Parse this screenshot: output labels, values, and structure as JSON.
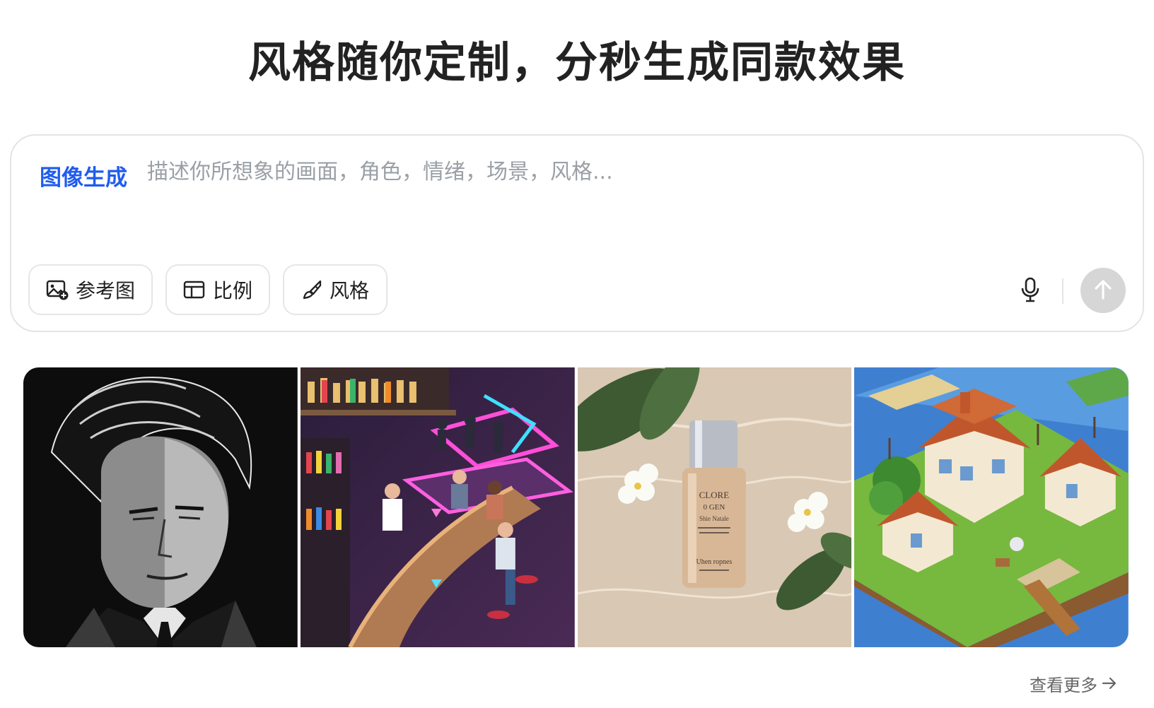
{
  "headline": "风格随你定制，分秒生成同款效果",
  "prompt_card": {
    "mode_label": "图像生成",
    "placeholder": "描述你所想象的画面，角色，情绪，场景，风格...",
    "value": "",
    "tools": [
      {
        "label": "参考图",
        "icon": "image-add-icon"
      },
      {
        "label": "比例",
        "icon": "aspect-ratio-icon"
      },
      {
        "label": "风格",
        "icon": "brush-icon"
      }
    ],
    "mic_icon": "microphone-icon",
    "send_icon": "arrow-up-icon"
  },
  "gallery": {
    "items": [
      {
        "subject": "manga-style-portrait"
      },
      {
        "subject": "neon-bar-scene"
      },
      {
        "subject": "cosmetic-bottle-product",
        "bottle_label_line1": "CLORE",
        "bottle_label_line2": "0 GEN",
        "bottle_label_line3": "Shie Natale",
        "bottle_label_line4": "Uhen ropnes"
      },
      {
        "subject": "isometric-island-houses"
      }
    ]
  },
  "more_link": {
    "label": "查看更多",
    "icon": "arrow-right-icon"
  },
  "colors": {
    "accent": "#1f5cf0",
    "send_disabled": "#d6d6d6",
    "border": "#e4e4e7",
    "placeholder": "#9aa0a6"
  }
}
